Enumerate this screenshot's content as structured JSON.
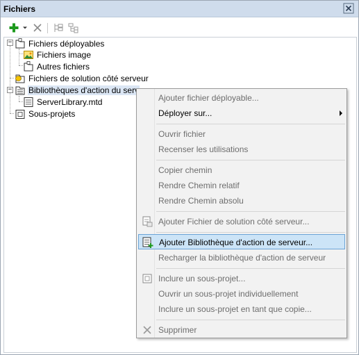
{
  "window": {
    "title": "Fichiers"
  },
  "toolbar": {
    "add_icon": "plus-icon",
    "dropdown_icon": "chevron-down-icon",
    "delete_icon": "x-icon",
    "tree_icon_1": "tree-expand-icon",
    "tree_icon_2": "tree-collapse-icon"
  },
  "tree": {
    "deployable": "Fichiers déployables",
    "images": "Fichiers image",
    "others": "Autres fichiers",
    "server_solution": "Fichiers de solution côté serveur",
    "server_libraries": "Bibliothèques d'action du serv",
    "library_file": "ServerLibrary.mtd",
    "subprojects": "Sous-projets"
  },
  "context_menu": {
    "items": [
      {
        "label": "Ajouter fichier déployable...",
        "enabled": false
      },
      {
        "label": "Déployer sur...",
        "enabled": true,
        "submenu": true
      },
      {
        "label": "Ouvrir fichier",
        "enabled": false
      },
      {
        "label": "Recenser les utilisations",
        "enabled": false
      },
      {
        "label": "Copier chemin",
        "enabled": false
      },
      {
        "label": "Rendre Chemin relatif",
        "enabled": false
      },
      {
        "label": "Rendre Chemin absolu",
        "enabled": false
      },
      {
        "label": "Ajouter Fichier de solution côté serveur...",
        "enabled": false
      },
      {
        "label": "Ajouter Bibliothèque d'action de serveur...",
        "enabled": true,
        "highlighted": true
      },
      {
        "label": "Recharger la bibliothèque d'action de serveur",
        "enabled": false
      },
      {
        "label": "Inclure un sous-projet...",
        "enabled": false
      },
      {
        "label": "Ouvrir un sous-projet individuellement",
        "enabled": false
      },
      {
        "label": "Inclure un sous-projet en tant que copie...",
        "enabled": false
      },
      {
        "label": "Supprimer",
        "enabled": false
      }
    ]
  },
  "colors": {
    "title_bar": "#cfdcec",
    "menu_highlight": "#cce4f7",
    "menu_highlight_border": "#6aa3d6",
    "add_green": "#1e9a1e"
  }
}
